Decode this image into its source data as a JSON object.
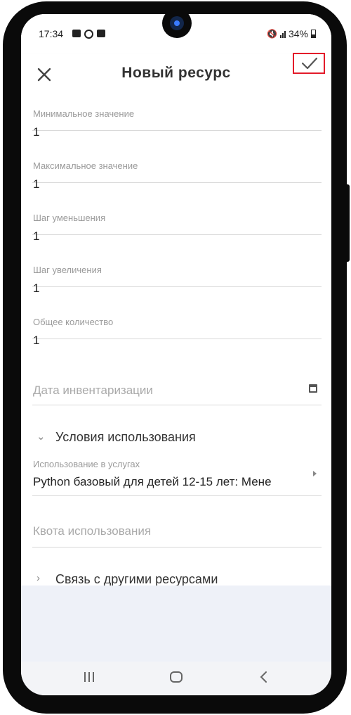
{
  "status_bar": {
    "time": "17:34",
    "battery": "34%"
  },
  "app_bar": {
    "title": "Новый ресурс",
    "close_icon": "close-icon",
    "save_icon": "check-icon",
    "highlight_color": "#e31b2a"
  },
  "fields": {
    "min_value": {
      "label": "Минимальное значение",
      "value": "1"
    },
    "max_value": {
      "label": "Максимальное значение",
      "value": "1"
    },
    "decrement_step": {
      "label": "Шаг уменьшения",
      "value": "1"
    },
    "increment_step": {
      "label": "Шаг увеличения",
      "value": "1"
    },
    "total_quantity": {
      "label": "Общее количество",
      "value": "1"
    },
    "inventory_date": {
      "placeholder": "Дата инвентаризации"
    }
  },
  "usage_conditions": {
    "title": "Условия использования",
    "service_usage": {
      "label": "Использование в услугах",
      "value": "Python базовый для детей 12-15 лет: Мене"
    },
    "quota": {
      "placeholder": "Квота использования"
    }
  },
  "related_resources": {
    "title": "Связь с другими ресурсами"
  }
}
